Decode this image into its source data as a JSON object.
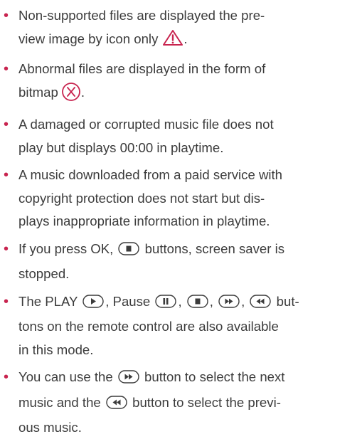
{
  "colors": {
    "text": "#3c3c3c",
    "bullet": "#c8244f",
    "icon_accent": "#c8244f"
  },
  "bullet_char": "•",
  "items": [
    {
      "l1": "Non-supported files are displayed the pre-",
      "l2a": "view image by icon only",
      "l2b": "."
    },
    {
      "l1": "Abnormal files are displayed in the form of",
      "l2a": "bitmap",
      "l2b": "."
    },
    {
      "l1": "A damaged or corrupted music file does not",
      "l2": "play but displays 00:00 in playtime."
    },
    {
      "l1": "A music downloaded from a paid service with",
      "l2": "copyright protection does not start but dis-",
      "l3": "plays inappropriate information in playtime."
    },
    {
      "l1a": "If you press OK,",
      "l1b": "buttons, screen saver is",
      "l2": "stopped."
    },
    {
      "l1a": "The PLAY",
      "l1b": ", Pause",
      "l1c": ",",
      "l1d": ",",
      "l1e": ",",
      "l1f": "but-",
      "l2": "tons on the remote control are also available",
      "l3": "in this mode."
    },
    {
      "l1a": "You can use the",
      "l1b": "button to select the next",
      "l2a": "music and the",
      "l2b": "button to select the previ-",
      "l3": "ous music."
    }
  ],
  "icons": {
    "warning": "warning-triangle-icon",
    "error": "circled-x-icon",
    "stop": "stop-button-icon",
    "play": "play-button-icon",
    "pause": "pause-button-icon",
    "fast_forward": "fast-forward-button-icon",
    "rewind": "rewind-button-icon"
  }
}
